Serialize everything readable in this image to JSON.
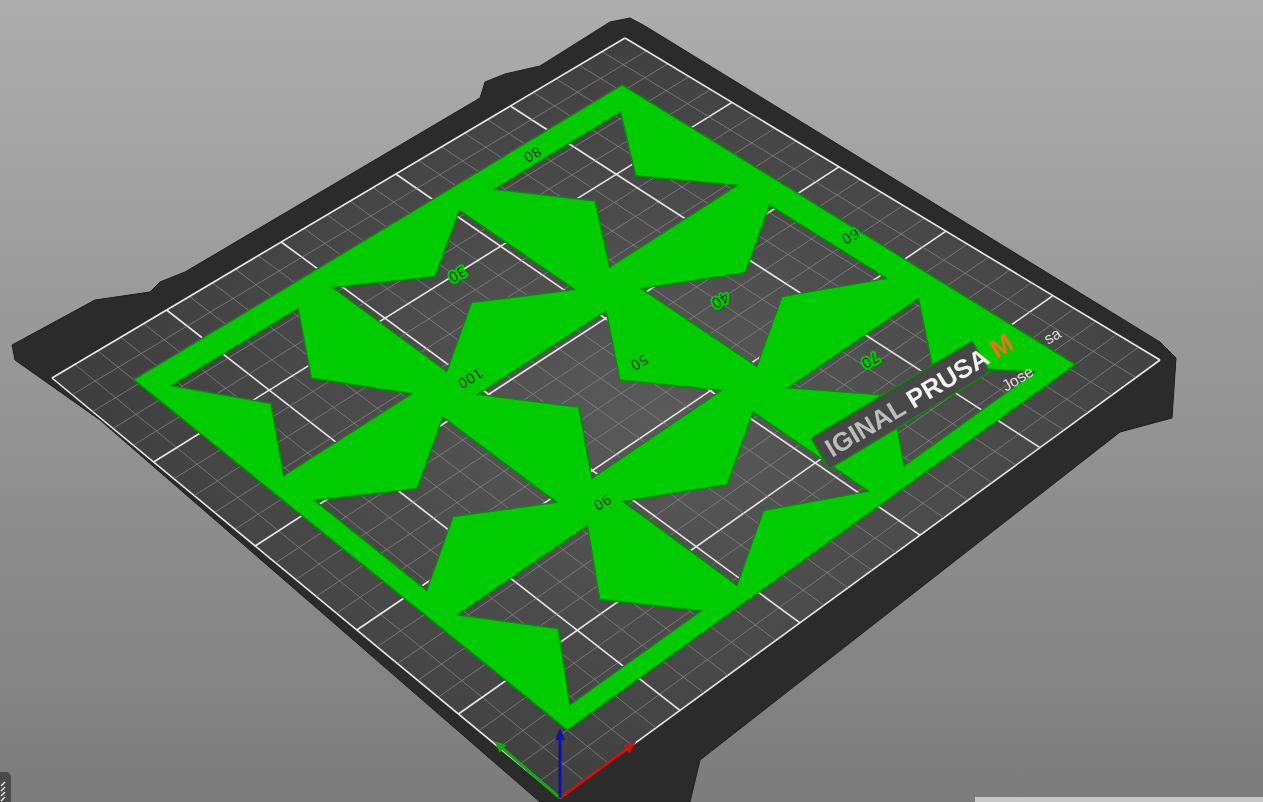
{
  "viewport": {
    "bed": {
      "logo": [
        {
          "text": "IGINAL",
          "kind": "dim"
        },
        {
          "text": "PRUSA",
          "kind": "bright"
        },
        {
          "text": "M",
          "kind": "accent"
        }
      ],
      "signature": [
        "Jose",
        "sa"
      ]
    },
    "model": {
      "labels": [
        "80",
        "30",
        "60",
        "40",
        "50",
        "100",
        "70",
        "90"
      ]
    }
  }
}
